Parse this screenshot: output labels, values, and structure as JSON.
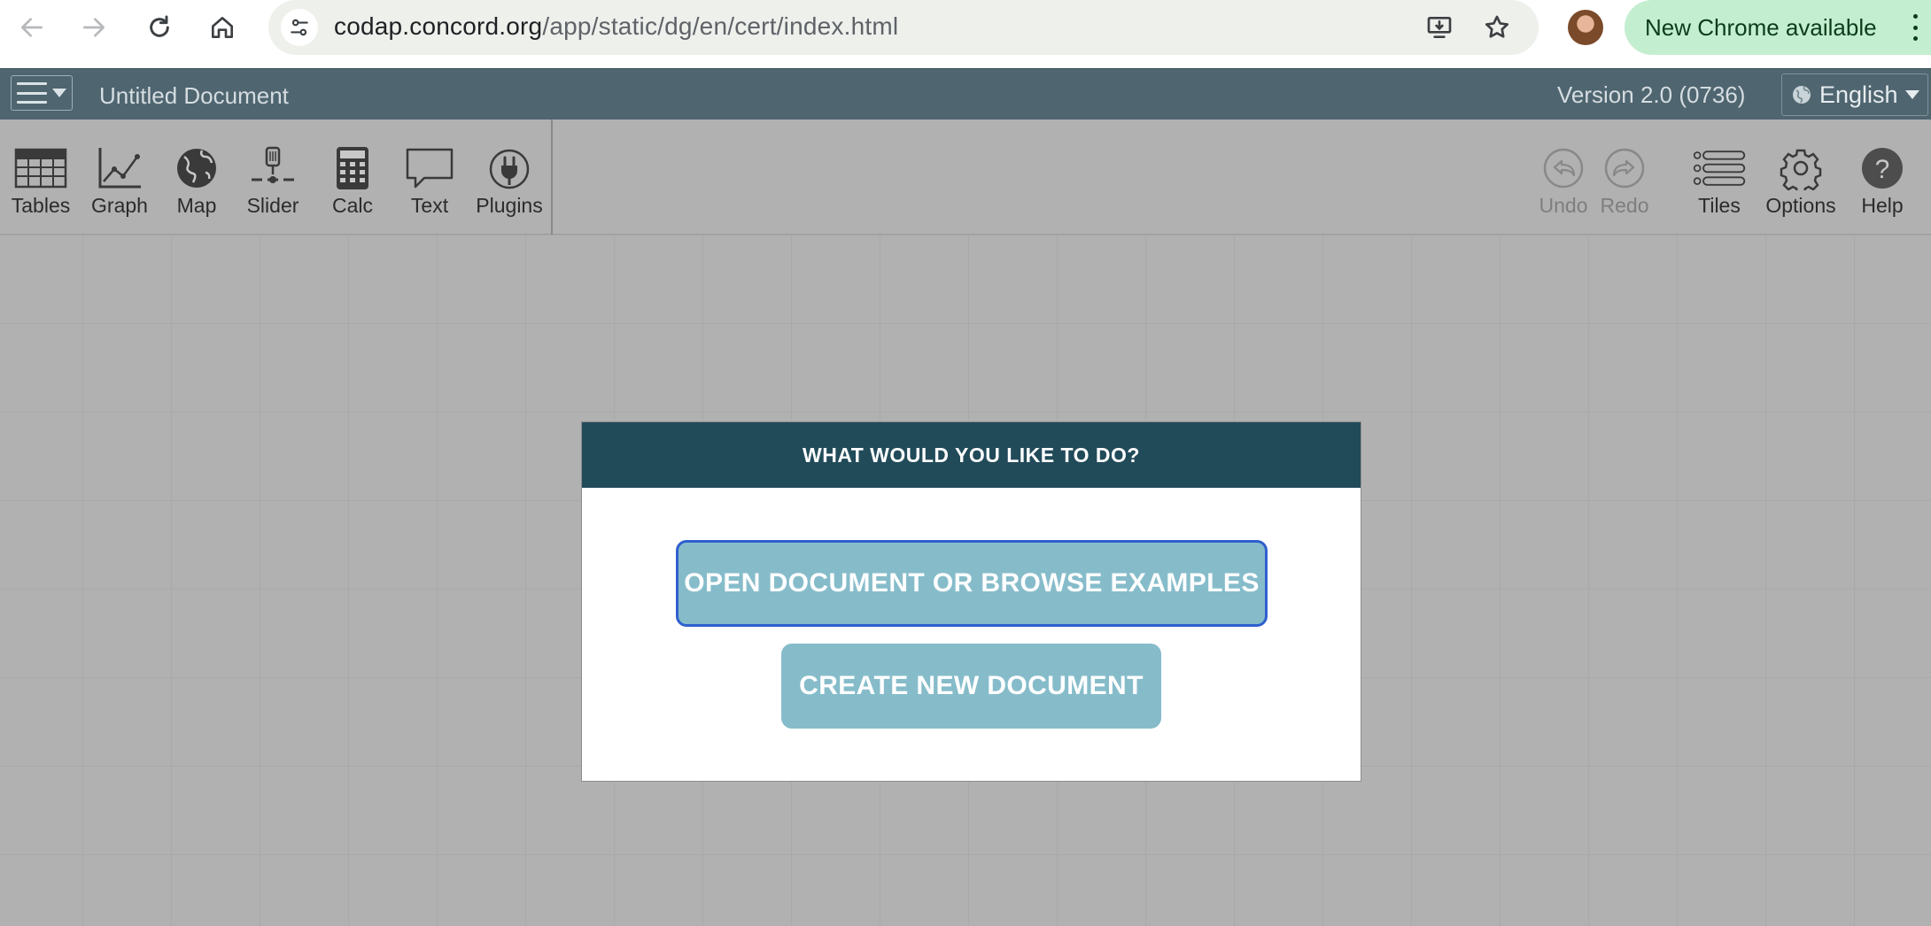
{
  "browser": {
    "url_host": "codap.concord.org",
    "url_path": "/app/static/dg/en/cert/index.html",
    "update_label": "New Chrome available"
  },
  "menubar": {
    "document_title": "Untitled Document",
    "version": "Version 2.0 (0736)",
    "language": "English"
  },
  "toolbar": {
    "left_tools": [
      {
        "label": "Tables",
        "icon": "table-icon"
      },
      {
        "label": "Graph",
        "icon": "graph-icon"
      },
      {
        "label": "Map",
        "icon": "globe-icon"
      },
      {
        "label": "Slider",
        "icon": "slider-icon"
      },
      {
        "label": "Calc",
        "icon": "calculator-icon"
      },
      {
        "label": "Text",
        "icon": "speech-bubble-icon"
      },
      {
        "label": "Plugins",
        "icon": "plug-icon"
      }
    ],
    "right_tools": [
      {
        "label": "Undo",
        "icon": "undo-icon",
        "enabled": false
      },
      {
        "label": "Redo",
        "icon": "redo-icon",
        "enabled": false
      },
      {
        "label": "Tiles",
        "icon": "tiles-list-icon"
      },
      {
        "label": "Options",
        "icon": "gear-icon"
      },
      {
        "label": "Help",
        "icon": "help-icon"
      }
    ]
  },
  "dialog": {
    "title": "WHAT WOULD YOU LIKE TO DO?",
    "open_button": "OPEN DOCUMENT OR BROWSE EXAMPLES",
    "create_button": "CREATE NEW DOCUMENT"
  },
  "colors": {
    "menubar": "#4f6570",
    "dialog_header": "#224b5a",
    "button_fill": "#86bcca",
    "focus_ring": "#2f5fce",
    "workspace": "#b1b1b1"
  }
}
